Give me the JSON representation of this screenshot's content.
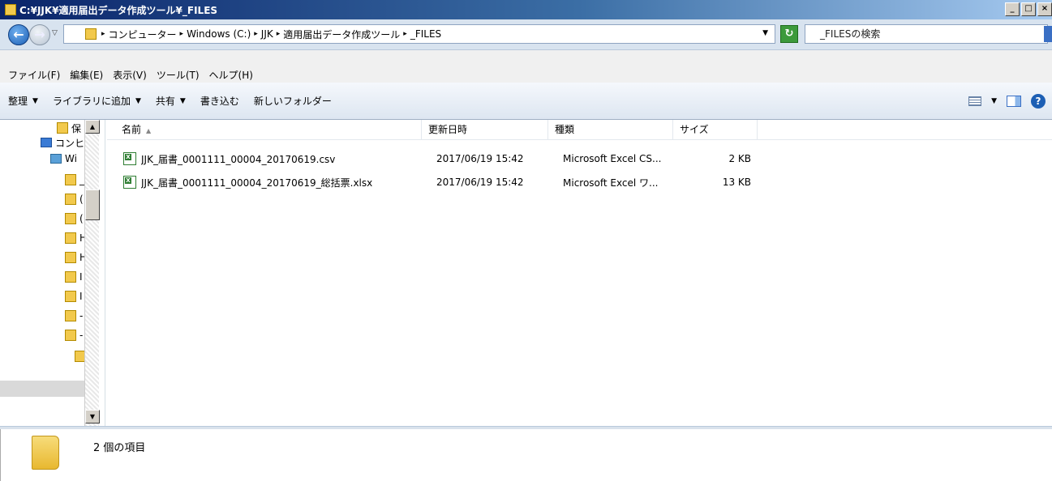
{
  "window": {
    "title": "C:¥JJK¥適用届出データ作成ツール¥_FILES"
  },
  "address": {
    "breadcrumbs": [
      "コンピューター",
      "Windows (C:)",
      "JJK",
      "適用届出データ作成ツール",
      "_FILES"
    ],
    "search_placeholder": "_FILESの検索"
  },
  "menu": [
    "ファイル(F)",
    "編集(E)",
    "表示(V)",
    "ツール(T)",
    "ヘルプ(H)"
  ],
  "toolbar": {
    "organize": "整理",
    "include_library": "ライブラリに追加",
    "share": "共有",
    "burn": "書き込む",
    "new_folder": "新しいフォルダー"
  },
  "navpane": {
    "items": [
      "保",
      "コンヒ",
      "Wi",
      "_",
      "(",
      "(",
      "H",
      "H",
      "I",
      "I",
      "-",
      "-"
    ]
  },
  "columns": [
    "名前",
    "更新日時",
    "種類",
    "サイズ"
  ],
  "files": [
    {
      "name": "JJK_届書_0001111_00004_20170619.csv",
      "modified": "2017/06/19 15:42",
      "type": "Microsoft Excel CS...",
      "size": "2 KB"
    },
    {
      "name": "JJK_届書_0001111_00004_20170619_総括票.xlsx",
      "modified": "2017/06/19 15:42",
      "type": "Microsoft Excel ワ...",
      "size": "13 KB"
    }
  ],
  "status": {
    "item_count": "2 個の項目"
  }
}
